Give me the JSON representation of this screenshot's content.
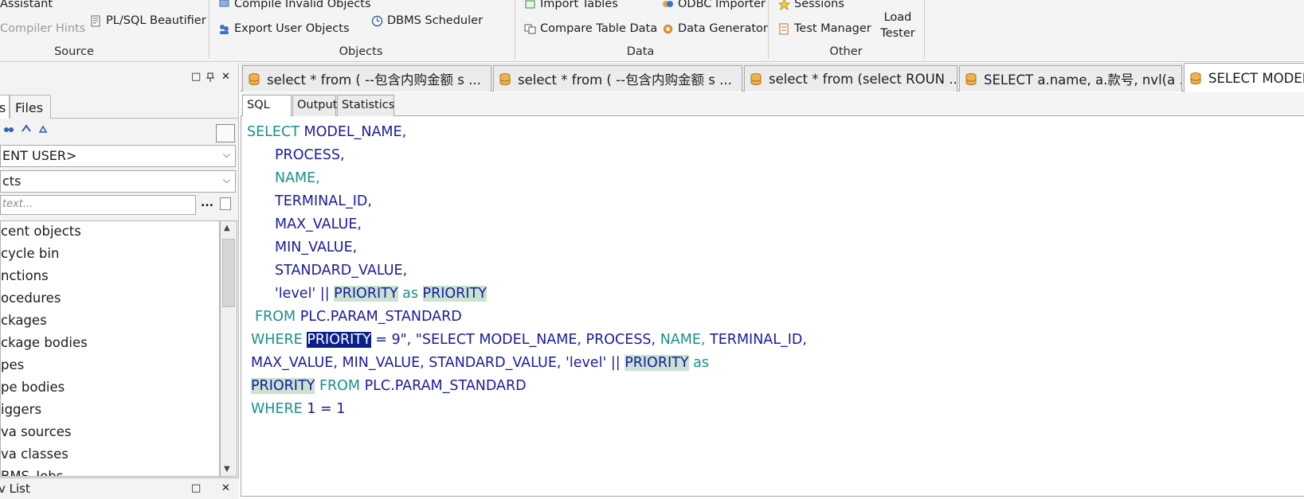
{
  "ribbon": {
    "source": {
      "label": "Source",
      "assistant": "Assistant",
      "compiler_hints": "Compiler Hints",
      "beautifier": "PL/SQL Beautifier"
    },
    "objects": {
      "label": "Objects",
      "compile_invalid": "Compile Invalid Objects",
      "export_user": "Export User Objects",
      "dbms_scheduler": "DBMS Scheduler"
    },
    "data": {
      "label": "Data",
      "import_tables": "Import Tables",
      "compare_table_data": "Compare Table Data",
      "odbc_importer": "ODBC Importer",
      "data_generator": "Data Generator"
    },
    "other": {
      "label": "Other",
      "sessions": "Sessions",
      "test_manager": "Test Manager",
      "load_tester_1": "Load",
      "load_tester_2": "Tester"
    }
  },
  "left_panel": {
    "window_controls": {
      "restore": "□",
      "pin": "📌",
      "close": "✕"
    },
    "tabs": [
      "s",
      "Files"
    ],
    "user_select": "ENT USER>",
    "type_select": "cts",
    "filter_placeholder": "text...",
    "ellipsis": "...",
    "tree": [
      "cent objects",
      "cycle bin",
      "nctions",
      "ocedures",
      "ckages",
      "ckage bodies",
      "pes",
      "pe bodies",
      "iggers",
      "va sources",
      "va classes",
      "BMS_Jobs"
    ],
    "bottom_title": "v List"
  },
  "doc_tabs": [
    {
      "title": "select * from ( --包含内购金额 s ..."
    },
    {
      "title": "select * from ( --包含内购金额 s ..."
    },
    {
      "title": "select * from (select ROUN ..."
    },
    {
      "title": "SELECT a.name, a.款号, nvl(a ..."
    },
    {
      "title": "SELECT MODEL_"
    }
  ],
  "sub_tabs": [
    "SQL",
    "Output",
    "Statistics"
  ],
  "code": {
    "l1_kw": "SELECT",
    "l1_id": "MODEL_NAME,",
    "l2": "PROCESS,",
    "l3": "NAME,",
    "l4": "TERMINAL_ID,",
    "l5": "MAX_VALUE,",
    "l6": "MIN_VALUE,",
    "l7": "STANDARD_VALUE,",
    "l8_str": "'level' ||",
    "l8_p1": "PRIORITY",
    "l8_as": "as",
    "l8_p2": "PRIORITY",
    "l9_kw": "FROM",
    "l9_id": "PLC.PARAM_STANDARD",
    "l10_kw": "WHERE",
    "l10_sel": "PRIORITY",
    "l10_rest": "= 9\", \"SELECT",
    "l10_a": "MODEL_NAME, PROCESS,",
    "l10_name": "NAME,",
    "l10_b": "TERMINAL_ID,",
    "l11_a": "MAX_VALUE, MIN_VALUE, STANDARD_VALUE, 'level' ||",
    "l11_p": "PRIORITY",
    "l11_as": "as",
    "l12_p": "PRIORITY",
    "l12_kw": "FROM",
    "l12_id": "PLC.PARAM_STANDARD",
    "l13_kw": "WHERE",
    "l13_rest": "1 = 1"
  }
}
